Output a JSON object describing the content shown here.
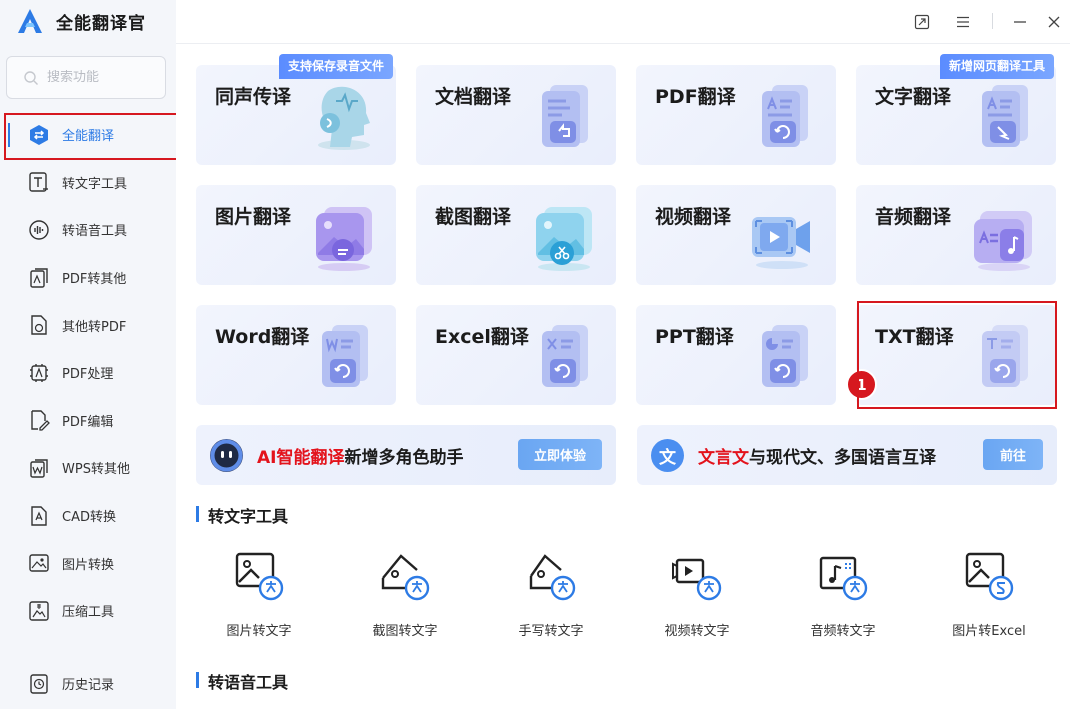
{
  "app": {
    "title": "全能翻译官"
  },
  "search": {
    "placeholder": "搜索功能"
  },
  "sidebar": {
    "items": [
      {
        "label": "全能翻译",
        "icon": "translate-icon"
      },
      {
        "label": "转文字工具",
        "icon": "text-tool-icon"
      },
      {
        "label": "转语音工具",
        "icon": "voice-tool-icon"
      },
      {
        "label": "PDF转其他",
        "icon": "pdf-export-icon"
      },
      {
        "label": "其他转PDF",
        "icon": "to-pdf-icon"
      },
      {
        "label": "PDF处理",
        "icon": "pdf-process-icon"
      },
      {
        "label": "PDF编辑",
        "icon": "pdf-edit-icon"
      },
      {
        "label": "WPS转其他",
        "icon": "wps-icon"
      },
      {
        "label": "CAD转换",
        "icon": "cad-icon"
      },
      {
        "label": "图片转换",
        "icon": "image-convert-icon"
      },
      {
        "label": "压缩工具",
        "icon": "compress-icon"
      }
    ],
    "history": "历史记录"
  },
  "cards": [
    {
      "label": "同声传译",
      "badge": "支持保存录音文件"
    },
    {
      "label": "文档翻译"
    },
    {
      "label": "PDF翻译"
    },
    {
      "label": "文字翻译",
      "badge": "新增网页翻译工具"
    },
    {
      "label": "图片翻译"
    },
    {
      "label": "截图翻译"
    },
    {
      "label": "视频翻译"
    },
    {
      "label": "音频翻译"
    },
    {
      "label": "Word翻译"
    },
    {
      "label": "Excel翻译"
    },
    {
      "label": "PPT翻译"
    },
    {
      "label": "TXT翻译"
    }
  ],
  "step_marker": "1",
  "banners": [
    {
      "highlight": "AI智能翻译",
      "text": "新增多角色助手",
      "button": "立即体验"
    },
    {
      "highlight": "文言文",
      "text": "与现代文、多国语言互译",
      "button": "前往",
      "icon_char": "文"
    }
  ],
  "sections": {
    "text_tools": "转文字工具",
    "voice_tools": "转语音工具"
  },
  "text_tools": [
    {
      "label": "图片转文字"
    },
    {
      "label": "截图转文字"
    },
    {
      "label": "手写转文字"
    },
    {
      "label": "视频转文字"
    },
    {
      "label": "音频转文字"
    },
    {
      "label": "图片转Excel"
    }
  ],
  "colors": {
    "accent": "#2d7be5",
    "highlight_red": "#e3131c",
    "card_bg": "#eef2fd",
    "badge_blue": "#5b8cff"
  }
}
